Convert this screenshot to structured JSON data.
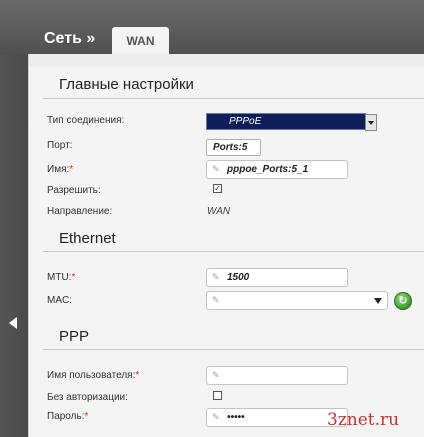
{
  "header": {
    "breadcrumb": "Сеть »",
    "tab": "WAN"
  },
  "sections": {
    "main": "Главные настройки",
    "ethernet": "Ethernet",
    "ppp": "PPP"
  },
  "fields": {
    "connection_type": {
      "label": "Тип соединения:",
      "value": "PPPoE"
    },
    "port": {
      "label": "Порт:",
      "value": "Ports:5"
    },
    "name": {
      "label": "Имя:",
      "required": "*",
      "value": "pppoe_Ports:5_1"
    },
    "enable": {
      "label": "Разрешить:",
      "checked": "✓"
    },
    "direction": {
      "label": "Направление:",
      "value": "WAN"
    },
    "mtu": {
      "label": "MTU:",
      "required": "*",
      "value": "1500"
    },
    "mac": {
      "label": "MAC:",
      "value": ""
    },
    "username": {
      "label": "Имя пользователя:",
      "required": "*",
      "value": ""
    },
    "no_auth": {
      "label": "Без авторизации:",
      "checked": ""
    },
    "password": {
      "label": "Пароль:",
      "required": "*",
      "value": "•••••"
    }
  },
  "watermark": "3znet.ru",
  "icons": {
    "back": "chevron-left-icon",
    "pencil": "pencil-icon",
    "refresh": "refresh-icon"
  }
}
